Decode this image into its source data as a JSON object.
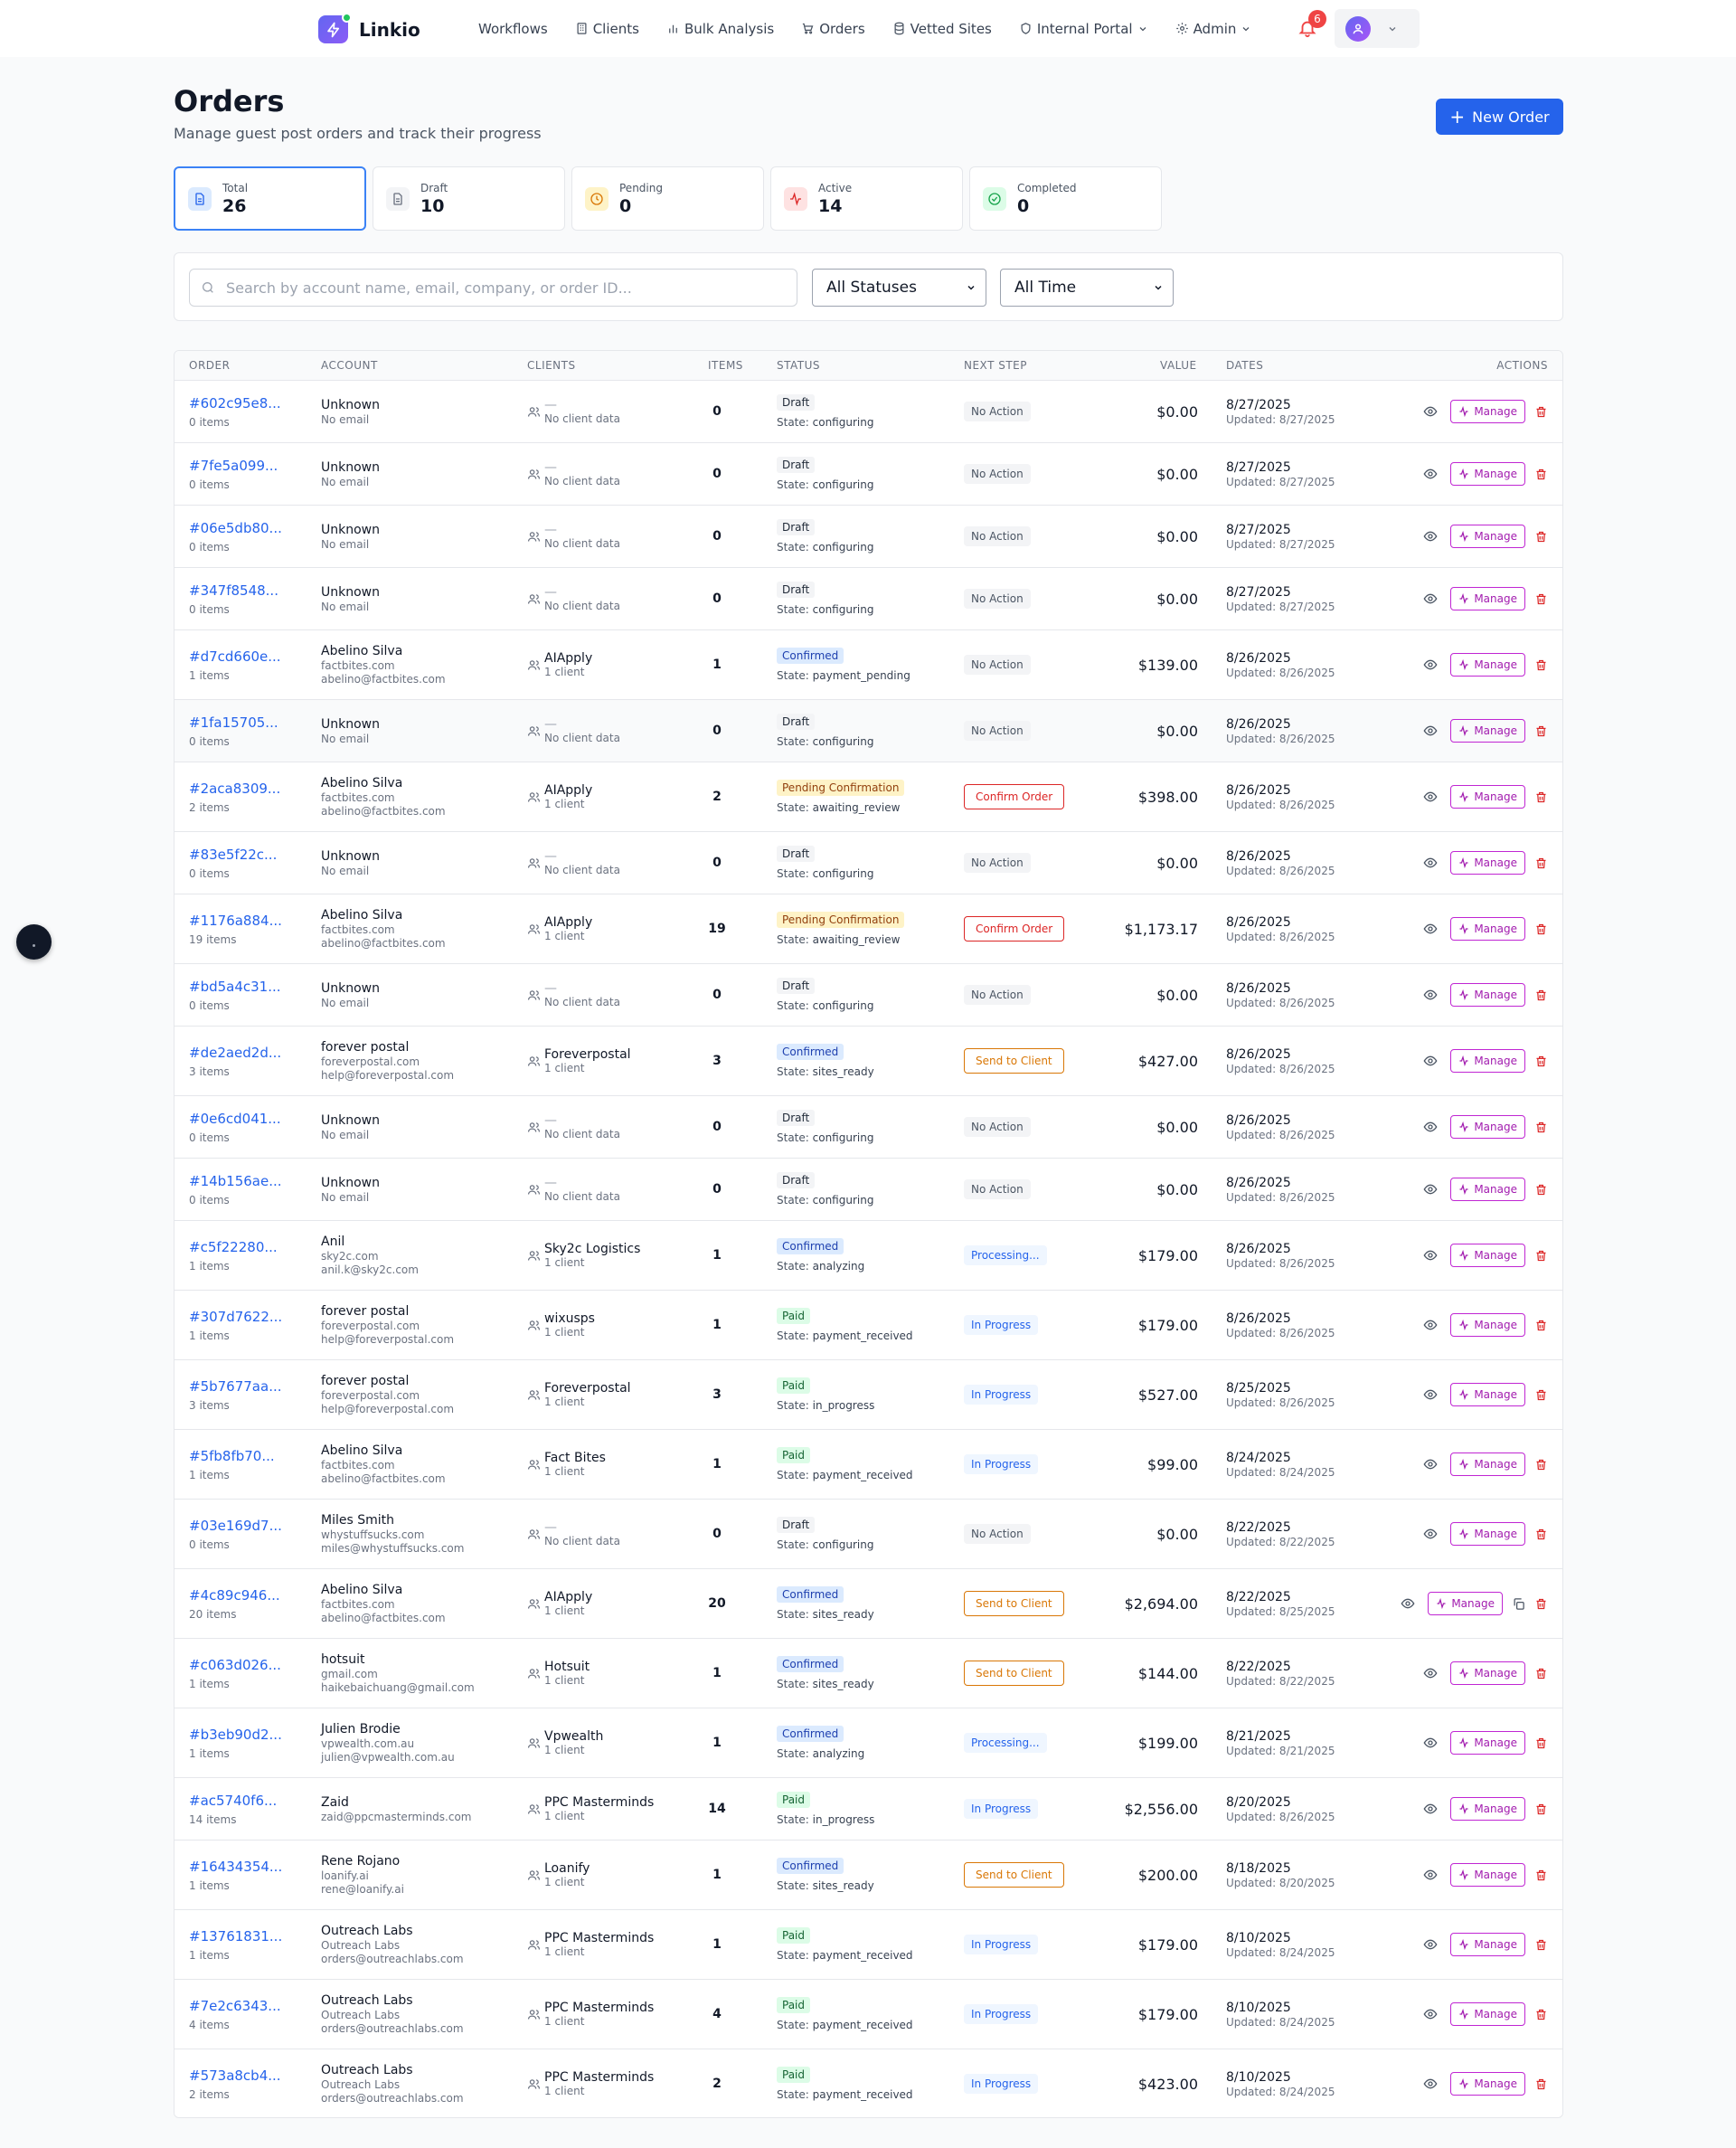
{
  "app": {
    "name": "Linkio",
    "notifications": "6"
  },
  "nav": {
    "items": [
      {
        "label": "Workflows",
        "icon": "none"
      },
      {
        "label": "Clients",
        "icon": "building-icon"
      },
      {
        "label": "Bulk Analysis",
        "icon": "bar-chart-icon"
      },
      {
        "label": "Orders",
        "icon": "cart-icon"
      },
      {
        "label": "Vetted Sites",
        "icon": "database-icon"
      },
      {
        "label": "Internal Portal",
        "icon": "shield-icon"
      },
      {
        "label": "Admin",
        "icon": "gear-icon"
      }
    ]
  },
  "header": {
    "title": "Orders",
    "subtitle": "Manage guest post orders and track their progress",
    "new_order": "New Order"
  },
  "stats": [
    {
      "label": "Total",
      "value": "26",
      "color": "#2563eb"
    },
    {
      "label": "Draft",
      "value": "10",
      "color": "#6b7280"
    },
    {
      "label": "Pending",
      "value": "0",
      "color": "#d97706"
    },
    {
      "label": "Active",
      "value": "14",
      "color": "#dc2626"
    },
    {
      "label": "Completed",
      "value": "0",
      "color": "#16a34a"
    }
  ],
  "filters": {
    "search_placeholder": "Search by account name, email, company, or order ID...",
    "status": "All Statuses",
    "time": "All Time"
  },
  "table": {
    "columns": [
      "ORDER",
      "ACCOUNT",
      "CLIENTS",
      "ITEMS",
      "STATUS",
      "NEXT STEP",
      "VALUE",
      "DATES",
      "ACTIONS"
    ],
    "manage_label": "Manage",
    "rows": [
      {
        "id": "#602c95e8...",
        "items_text": "0 items",
        "account": "Unknown",
        "sub1": "No email",
        "sub2": "",
        "client": "—",
        "client_sub": "No client data",
        "items": "0",
        "status": "Draft",
        "status_kind": "draft",
        "state": "configuring",
        "next": "No Action",
        "next_kind": "none",
        "value": "$0.00",
        "date": "8/27/2025",
        "updated": "Updated: 8/27/2025"
      },
      {
        "id": "#7fe5a099...",
        "items_text": "0 items",
        "account": "Unknown",
        "sub1": "No email",
        "sub2": "",
        "client": "—",
        "client_sub": "No client data",
        "items": "0",
        "status": "Draft",
        "status_kind": "draft",
        "state": "configuring",
        "next": "No Action",
        "next_kind": "none",
        "value": "$0.00",
        "date": "8/27/2025",
        "updated": "Updated: 8/27/2025"
      },
      {
        "id": "#06e5db80...",
        "items_text": "0 items",
        "account": "Unknown",
        "sub1": "No email",
        "sub2": "",
        "client": "—",
        "client_sub": "No client data",
        "items": "0",
        "status": "Draft",
        "status_kind": "draft",
        "state": "configuring",
        "next": "No Action",
        "next_kind": "none",
        "value": "$0.00",
        "date": "8/27/2025",
        "updated": "Updated: 8/27/2025"
      },
      {
        "id": "#347f8548...",
        "items_text": "0 items",
        "account": "Unknown",
        "sub1": "No email",
        "sub2": "",
        "client": "—",
        "client_sub": "No client data",
        "items": "0",
        "status": "Draft",
        "status_kind": "draft",
        "state": "configuring",
        "next": "No Action",
        "next_kind": "none",
        "value": "$0.00",
        "date": "8/27/2025",
        "updated": "Updated: 8/27/2025"
      },
      {
        "id": "#d7cd660e...",
        "items_text": "1 items",
        "account": "Abelino Silva",
        "sub1": "factbites.com",
        "sub2": "abelino@factbites.com",
        "client": "AIApply",
        "client_sub": "1 client",
        "items": "1",
        "status": "Confirmed",
        "status_kind": "confirmed",
        "state": "payment_pending",
        "next": "No Action",
        "next_kind": "none",
        "value": "$139.00",
        "date": "8/26/2025",
        "updated": "Updated: 8/26/2025"
      },
      {
        "id": "#1fa15705...",
        "items_text": "0 items",
        "account": "Unknown",
        "sub1": "No email",
        "sub2": "",
        "client": "—",
        "client_sub": "No client data",
        "items": "0",
        "status": "Draft",
        "status_kind": "draft",
        "state": "configuring",
        "next": "No Action",
        "next_kind": "none",
        "value": "$0.00",
        "date": "8/26/2025",
        "updated": "Updated: 8/26/2025",
        "highlight": true
      },
      {
        "id": "#2aca8309...",
        "items_text": "2 items",
        "account": "Abelino Silva",
        "sub1": "factbites.com",
        "sub2": "abelino@factbites.com",
        "client": "AIApply",
        "client_sub": "1 client",
        "items": "2",
        "status": "Pending Confirmation",
        "status_kind": "pending",
        "state": "awaiting_review",
        "next": "Confirm Order",
        "next_kind": "confirm",
        "value": "$398.00",
        "date": "8/26/2025",
        "updated": "Updated: 8/26/2025"
      },
      {
        "id": "#83e5f22c...",
        "items_text": "0 items",
        "account": "Unknown",
        "sub1": "No email",
        "sub2": "",
        "client": "—",
        "client_sub": "No client data",
        "items": "0",
        "status": "Draft",
        "status_kind": "draft",
        "state": "configuring",
        "next": "No Action",
        "next_kind": "none",
        "value": "$0.00",
        "date": "8/26/2025",
        "updated": "Updated: 8/26/2025"
      },
      {
        "id": "#1176a884...",
        "items_text": "19 items",
        "account": "Abelino Silva",
        "sub1": "factbites.com",
        "sub2": "abelino@factbites.com",
        "client": "AIApply",
        "client_sub": "1 client",
        "items": "19",
        "status": "Pending Confirmation",
        "status_kind": "pending",
        "state": "awaiting_review",
        "next": "Confirm Order",
        "next_kind": "confirm",
        "value": "$1,173.17",
        "date": "8/26/2025",
        "updated": "Updated: 8/26/2025"
      },
      {
        "id": "#bd5a4c31...",
        "items_text": "0 items",
        "account": "Unknown",
        "sub1": "No email",
        "sub2": "",
        "client": "—",
        "client_sub": "No client data",
        "items": "0",
        "status": "Draft",
        "status_kind": "draft",
        "state": "configuring",
        "next": "No Action",
        "next_kind": "none",
        "value": "$0.00",
        "date": "8/26/2025",
        "updated": "Updated: 8/26/2025"
      },
      {
        "id": "#de2aed2d...",
        "items_text": "3 items",
        "account": "forever postal",
        "sub1": "foreverpostal.com",
        "sub2": "help@foreverpostal.com",
        "client": "Foreverpostal",
        "client_sub": "1 client",
        "items": "3",
        "status": "Confirmed",
        "status_kind": "confirmed",
        "state": "sites_ready",
        "next": "Send to Client",
        "next_kind": "send",
        "value": "$427.00",
        "date": "8/26/2025",
        "updated": "Updated: 8/26/2025"
      },
      {
        "id": "#0e6cd041...",
        "items_text": "0 items",
        "account": "Unknown",
        "sub1": "No email",
        "sub2": "",
        "client": "—",
        "client_sub": "No client data",
        "items": "0",
        "status": "Draft",
        "status_kind": "draft",
        "state": "configuring",
        "next": "No Action",
        "next_kind": "none",
        "value": "$0.00",
        "date": "8/26/2025",
        "updated": "Updated: 8/26/2025"
      },
      {
        "id": "#14b156ae...",
        "items_text": "0 items",
        "account": "Unknown",
        "sub1": "No email",
        "sub2": "",
        "client": "—",
        "client_sub": "No client data",
        "items": "0",
        "status": "Draft",
        "status_kind": "draft",
        "state": "configuring",
        "next": "No Action",
        "next_kind": "none",
        "value": "$0.00",
        "date": "8/26/2025",
        "updated": "Updated: 8/26/2025"
      },
      {
        "id": "#c5f22280...",
        "items_text": "1 items",
        "account": "Anil",
        "sub1": "sky2c.com",
        "sub2": "anil.k@sky2c.com",
        "client": "Sky2c Logistics",
        "client_sub": "1 client",
        "items": "1",
        "status": "Confirmed",
        "status_kind": "confirmed",
        "state": "analyzing",
        "next": "Processing...",
        "next_kind": "proc",
        "value": "$179.00",
        "date": "8/26/2025",
        "updated": "Updated: 8/26/2025"
      },
      {
        "id": "#307d7622...",
        "items_text": "1 items",
        "account": "forever postal",
        "sub1": "foreverpostal.com",
        "sub2": "help@foreverpostal.com",
        "client": "wixusps",
        "client_sub": "1 client",
        "items": "1",
        "status": "Paid",
        "status_kind": "paid",
        "state": "payment_received",
        "next": "In Progress",
        "next_kind": "prog",
        "value": "$179.00",
        "date": "8/26/2025",
        "updated": "Updated: 8/26/2025"
      },
      {
        "id": "#5b7677aa...",
        "items_text": "3 items",
        "account": "forever postal",
        "sub1": "foreverpostal.com",
        "sub2": "help@foreverpostal.com",
        "client": "Foreverpostal",
        "client_sub": "1 client",
        "items": "3",
        "status": "Paid",
        "status_kind": "paid",
        "state": "in_progress",
        "next": "In Progress",
        "next_kind": "prog",
        "value": "$527.00",
        "date": "8/25/2025",
        "updated": "Updated: 8/26/2025"
      },
      {
        "id": "#5fb8fb70...",
        "items_text": "1 items",
        "account": "Abelino Silva",
        "sub1": "factbites.com",
        "sub2": "abelino@factbites.com",
        "client": "Fact Bites",
        "client_sub": "1 client",
        "items": "1",
        "status": "Paid",
        "status_kind": "paid",
        "state": "payment_received",
        "next": "In Progress",
        "next_kind": "prog",
        "value": "$99.00",
        "date": "8/24/2025",
        "updated": "Updated: 8/24/2025"
      },
      {
        "id": "#03e169d7...",
        "items_text": "0 items",
        "account": "Miles Smith",
        "sub1": "whystuffsucks.com",
        "sub2": "miles@whystuffsucks.com",
        "client": "—",
        "client_sub": "No client data",
        "items": "0",
        "status": "Draft",
        "status_kind": "draft",
        "state": "configuring",
        "next": "No Action",
        "next_kind": "none",
        "value": "$0.00",
        "date": "8/22/2025",
        "updated": "Updated: 8/22/2025"
      },
      {
        "id": "#4c89c946...",
        "items_text": "20 items",
        "account": "Abelino Silva",
        "sub1": "factbites.com",
        "sub2": "abelino@factbites.com",
        "client": "AIApply",
        "client_sub": "1 client",
        "items": "20",
        "status": "Confirmed",
        "status_kind": "confirmed",
        "state": "sites_ready",
        "next": "Send to Client",
        "next_kind": "send",
        "value": "$2,694.00",
        "date": "8/22/2025",
        "updated": "Updated: 8/25/2025",
        "copy": true
      },
      {
        "id": "#c063d026...",
        "items_text": "1 items",
        "account": "hotsuit",
        "sub1": "gmail.com",
        "sub2": "haikebaichuang@gmail.com",
        "client": "Hotsuit",
        "client_sub": "1 client",
        "items": "1",
        "status": "Confirmed",
        "status_kind": "confirmed",
        "state": "sites_ready",
        "next": "Send to Client",
        "next_kind": "send",
        "value": "$144.00",
        "date": "8/22/2025",
        "updated": "Updated: 8/22/2025"
      },
      {
        "id": "#b3eb90d2...",
        "items_text": "1 items",
        "account": "Julien Brodie",
        "sub1": "vpwealth.com.au",
        "sub2": "julien@vpwealth.com.au",
        "client": "Vpwealth",
        "client_sub": "1 client",
        "items": "1",
        "status": "Confirmed",
        "status_kind": "confirmed",
        "state": "analyzing",
        "next": "Processing...",
        "next_kind": "proc",
        "value": "$199.00",
        "date": "8/21/2025",
        "updated": "Updated: 8/21/2025"
      },
      {
        "id": "#ac5740f6...",
        "items_text": "14 items",
        "account": "Zaid",
        "sub1": "zaid@ppcmasterminds.com",
        "sub2": "",
        "client": "PPC Masterminds",
        "client_sub": "1 client",
        "items": "14",
        "status": "Paid",
        "status_kind": "paid",
        "state": "in_progress",
        "next": "In Progress",
        "next_kind": "prog",
        "value": "$2,556.00",
        "date": "8/20/2025",
        "updated": "Updated: 8/26/2025"
      },
      {
        "id": "#16434354...",
        "items_text": "1 items",
        "account": "Rene Rojano",
        "sub1": "loanify.ai",
        "sub2": "rene@loanify.ai",
        "client": "Loanify",
        "client_sub": "1 client",
        "items": "1",
        "status": "Confirmed",
        "status_kind": "confirmed",
        "state": "sites_ready",
        "next": "Send to Client",
        "next_kind": "send",
        "value": "$200.00",
        "date": "8/18/2025",
        "updated": "Updated: 8/20/2025"
      },
      {
        "id": "#13761831...",
        "items_text": "1 items",
        "account": "Outreach Labs",
        "sub1": "Outreach Labs",
        "sub2": "orders@outreachlabs.com",
        "client": "PPC Masterminds",
        "client_sub": "1 client",
        "items": "1",
        "status": "Paid",
        "status_kind": "paid",
        "state": "payment_received",
        "next": "In Progress",
        "next_kind": "prog",
        "value": "$179.00",
        "date": "8/10/2025",
        "updated": "Updated: 8/24/2025"
      },
      {
        "id": "#7e2c6343...",
        "items_text": "4 items",
        "account": "Outreach Labs",
        "sub1": "Outreach Labs",
        "sub2": "orders@outreachlabs.com",
        "client": "PPC Masterminds",
        "client_sub": "1 client",
        "items": "4",
        "status": "Paid",
        "status_kind": "paid",
        "state": "payment_received",
        "next": "In Progress",
        "next_kind": "prog",
        "value": "$179.00",
        "date": "8/10/2025",
        "updated": "Updated: 8/24/2025"
      },
      {
        "id": "#573a8cb4...",
        "items_text": "2 items",
        "account": "Outreach Labs",
        "sub1": "Outreach Labs",
        "sub2": "orders@outreachlabs.com",
        "client": "PPC Masterminds",
        "client_sub": "1 client",
        "items": "2",
        "status": "Paid",
        "status_kind": "paid",
        "state": "payment_received",
        "next": "In Progress",
        "next_kind": "prog",
        "value": "$423.00",
        "date": "8/10/2025",
        "updated": "Updated: 8/24/2025"
      }
    ]
  }
}
